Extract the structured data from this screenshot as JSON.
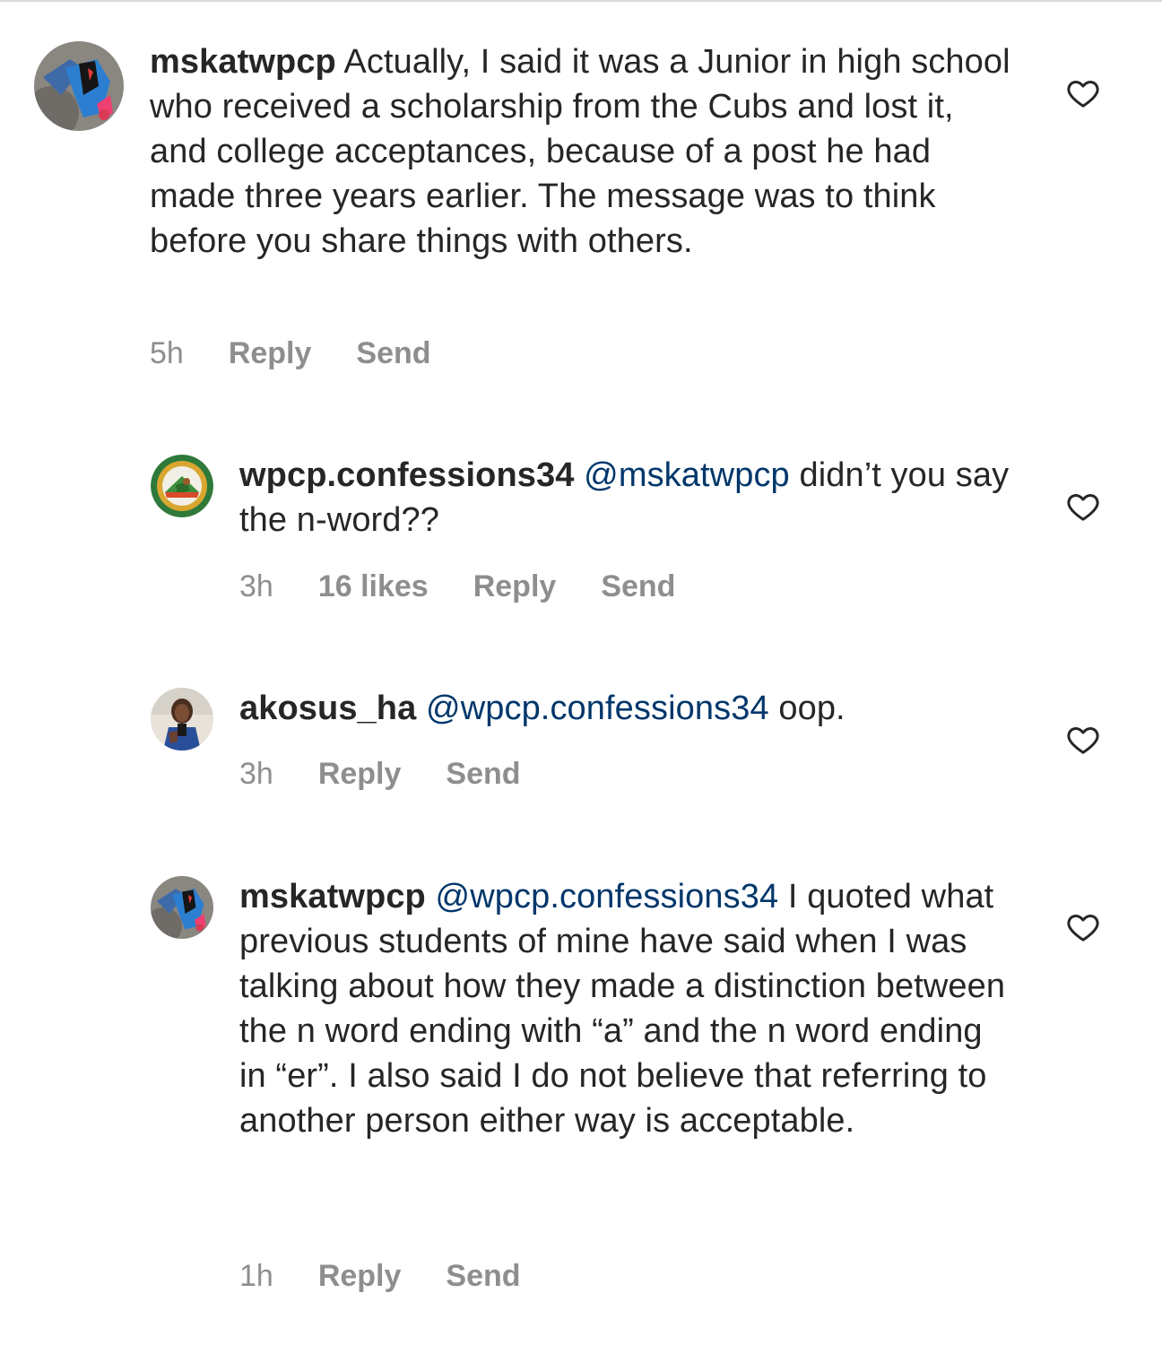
{
  "comments": [
    {
      "username": "mskatwpcp",
      "mention": "",
      "text": " Actually, I said it was a Junior in high school who received a scholarship from the Cubs and lost it, and college acceptances, because of a post he had made three years earlier. The message was to think before you share things with others.",
      "time": "5h",
      "likes": "",
      "reply_label": "Reply",
      "send_label": "Send",
      "avatar_icon": "sneaker-photo-avatar",
      "heart_icon": "heart-outline-icon"
    },
    {
      "username": "wpcp.confessions34",
      "mention": "@mskatwpcp",
      "text": " didn’t you say the n-word??",
      "time": "3h",
      "likes": "16 likes",
      "reply_label": "Reply",
      "send_label": "Send",
      "avatar_icon": "school-seal-avatar",
      "heart_icon": "heart-outline-icon"
    },
    {
      "username": "akosus_ha",
      "mention": "@wpcp.confessions34",
      "text": " oop.",
      "time": "3h",
      "likes": "",
      "reply_label": "Reply",
      "send_label": "Send",
      "avatar_icon": "person-photo-avatar",
      "heart_icon": "heart-outline-icon"
    },
    {
      "username": "mskatwpcp",
      "mention": "@wpcp.confessions34",
      "text": " I quoted what previous students of mine have said when I was talking about how they made a distinction between the n word ending with “a” and the n word ending in “er”. I also said I do not believe that referring to another person either way is acceptable.",
      "time": "1h",
      "likes": "",
      "reply_label": "Reply",
      "send_label": "Send",
      "avatar_icon": "sneaker-photo-avatar",
      "heart_icon": "heart-outline-icon"
    }
  ],
  "colors": {
    "text": "#262626",
    "mention": "#00376b",
    "meta": "#8e8e8e"
  }
}
